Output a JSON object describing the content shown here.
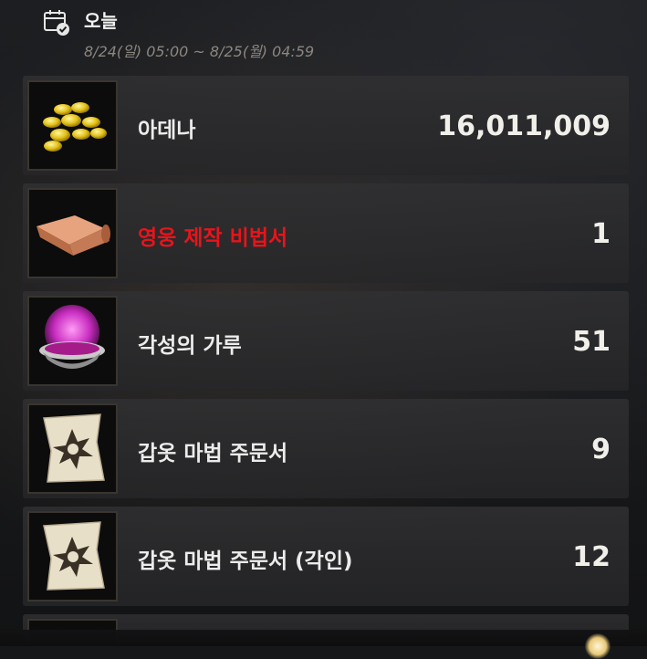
{
  "header": {
    "title": "오늘",
    "date_range": "8/24(일) 05:00 ~ 8/25(월) 04:59",
    "icon": "calendar-check-icon"
  },
  "items": [
    {
      "name": "아데나",
      "count": "16,011,009",
      "icon": "adena-coins-icon",
      "name_color": "#ececec"
    },
    {
      "name": "영웅 제작 비법서",
      "count": "1",
      "icon": "recipe-scroll-icon",
      "name_color": "#e8141b"
    },
    {
      "name": "각성의 가루",
      "count": "51",
      "icon": "awakening-powder-icon",
      "name_color": "#ececec"
    },
    {
      "name": "갑옷 마법 주문서",
      "count": "9",
      "icon": "armor-scroll-icon",
      "name_color": "#ececec"
    },
    {
      "name": "갑옷 마법 주문서 (각인)",
      "count": "12",
      "icon": "armor-scroll-icon",
      "name_color": "#ececec"
    }
  ]
}
